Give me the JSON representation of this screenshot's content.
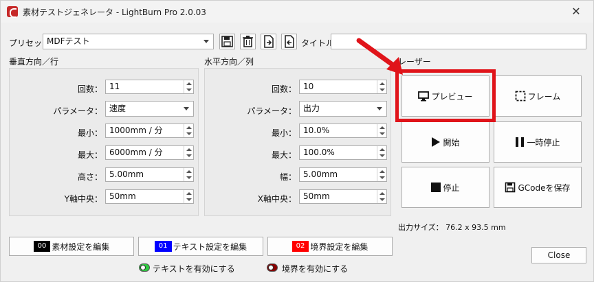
{
  "window": {
    "title": "素材テストジェネレータ - LightBurn Pro 2.0.03",
    "close_glyph": "✕"
  },
  "toolbar": {
    "preset_label": "プリセット",
    "preset_value": "MDFテスト",
    "title_label": "タイトル",
    "title_value": ""
  },
  "vertical": {
    "label": "垂直方向／行",
    "rows": [
      {
        "label": "回数：",
        "value": "11"
      },
      {
        "label": "パラメータ：",
        "value": "速度"
      },
      {
        "label": "最小：",
        "value": "1000mm / 分"
      },
      {
        "label": "最大：",
        "value": "6000mm / 分"
      },
      {
        "label": "高さ：",
        "value": "5.00mm"
      },
      {
        "label": "Y軸中央：",
        "value": "50mm"
      }
    ]
  },
  "horizontal": {
    "label": "水平方向／列",
    "rows": [
      {
        "label": "回数：",
        "value": "10"
      },
      {
        "label": "パラメータ：",
        "value": "出力"
      },
      {
        "label": "最小：",
        "value": "10.0%"
      },
      {
        "label": "最大：",
        "value": "100.0%"
      },
      {
        "label": "幅：",
        "value": "5.00mm"
      },
      {
        "label": "X軸中央：",
        "value": "50mm"
      }
    ]
  },
  "laser": {
    "label": "レーザー",
    "buttons": {
      "preview": "プレビュー",
      "frame": "フレーム",
      "start": "開始",
      "pause": "一時停止",
      "stop": "停止",
      "save_gcode": "GCodeを保存"
    },
    "output_size": "出力サイズ： 76.2 x 93.5 mm"
  },
  "bottom": {
    "edit_material": {
      "badge": "00",
      "label": "素材設定を編集",
      "color": "#000000"
    },
    "edit_text": {
      "badge": "01",
      "label": "テキスト設定を編集",
      "color": "#0000ff"
    },
    "edit_border": {
      "badge": "02",
      "label": "境界設定を編集",
      "color": "#ff0000"
    },
    "enable_text": "テキストを有効にする",
    "enable_border": "境界を有効にする",
    "close": "Close"
  },
  "colors": {
    "highlight": "#e0141a",
    "toggle_on": "#2ecc40",
    "toggle_off": "#8b0000"
  }
}
